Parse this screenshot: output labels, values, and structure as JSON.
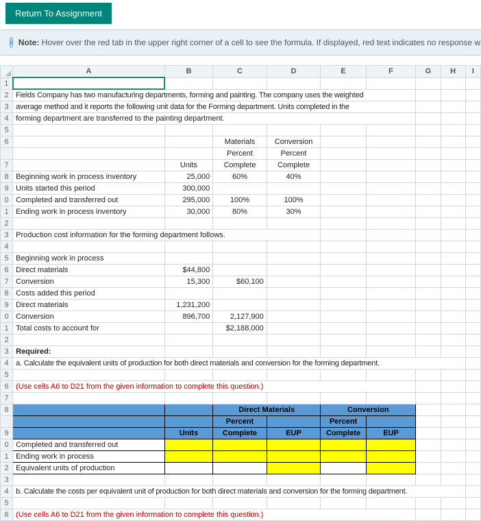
{
  "buttons": {
    "return": "Return To Assignment"
  },
  "note": {
    "label": "Note:",
    "text": "Hover over the red tab in the upper right corner of a cell to see the formula. If displayed, red text indicates no response w"
  },
  "cols": {
    "A": "A",
    "B": "B",
    "C": "C",
    "D": "D",
    "E": "E",
    "F": "F",
    "G": "G",
    "H": "H",
    "I": "I"
  },
  "rowlabels": [
    "1",
    "2",
    "3",
    "4",
    "5",
    "6",
    "7",
    "8",
    "9",
    "0",
    "1",
    "2",
    "3",
    "4",
    "5",
    "6",
    "7",
    "8",
    "9",
    "0",
    "1",
    "2",
    "3",
    "4",
    "5",
    "6",
    "7",
    "8",
    "9",
    "0",
    "1",
    "2",
    "3",
    "4",
    "5",
    "6"
  ],
  "r2A": "Fields Company has two manufacturing departments, forming and painting. The company uses the weighted",
  "r3A": "average method and it reports the following unit data for the Forming department. Units completed in the",
  "r4A": "forming department are transferred to the painting department.",
  "r6C": "Materials",
  "r6D": "Conversion",
  "r7C1": "Percent",
  "r7D1": "Percent",
  "r7B": "Units",
  "r7C": "Complete",
  "r7D": "Complete",
  "r8A": "Beginning work in process inventory",
  "r8B": "25,000",
  "r8C": "60%",
  "r8D": "40%",
  "r9A": "Units started this period",
  "r9B": "300,000",
  "r10A": "Completed and transferred out",
  "r10B": "295,000",
  "r10C": "100%",
  "r10D": "100%",
  "r11A": "Ending work in process inventory",
  "r11B": "30,000",
  "r11C": "80%",
  "r11D": "30%",
  "r13A": "Production cost information for the forming department follows.",
  "r15A": "Beginning work in process",
  "r16A": "  Direct materials",
  "r16B": "$44,800",
  "r17A": "  Conversion",
  "r17B": "15,300",
  "r17C": "$60,100",
  "r18A": "Costs added this period",
  "r19A": "  Direct materials",
  "r19B": "1,231,200",
  "r20A": "  Conversion",
  "r20B": "896,700",
  "r20C": "2,127,900",
  "r21A": "Total costs to account for",
  "r21C": "$2,188,000",
  "r23A": "Required:",
  "r24A": "a. Calculate the equivalent units of production for both direct materials and conversion for the forming department.",
  "r26A": "(Use cells A6 to D21 from the given information to complete this question.)",
  "r28CD": "Direct Materials",
  "r28EF": "Conversion",
  "r29B": "Units",
  "r29C1": "Percent",
  "r29C": "Complete",
  "r29D": "EUP",
  "r29E1": "Percent",
  "r29E": "Complete",
  "r29F": "EUP",
  "r30A": "Completed and transferred out",
  "r31A": "Ending work in process",
  "r32A": "Equivalent units of production",
  "r34A": "b. Calculate the costs per equivalent unit of production for both direct materials and conversion for the forming department.",
  "r36A": "(Use cells A6 to D21 from the given information to complete this question.)"
}
